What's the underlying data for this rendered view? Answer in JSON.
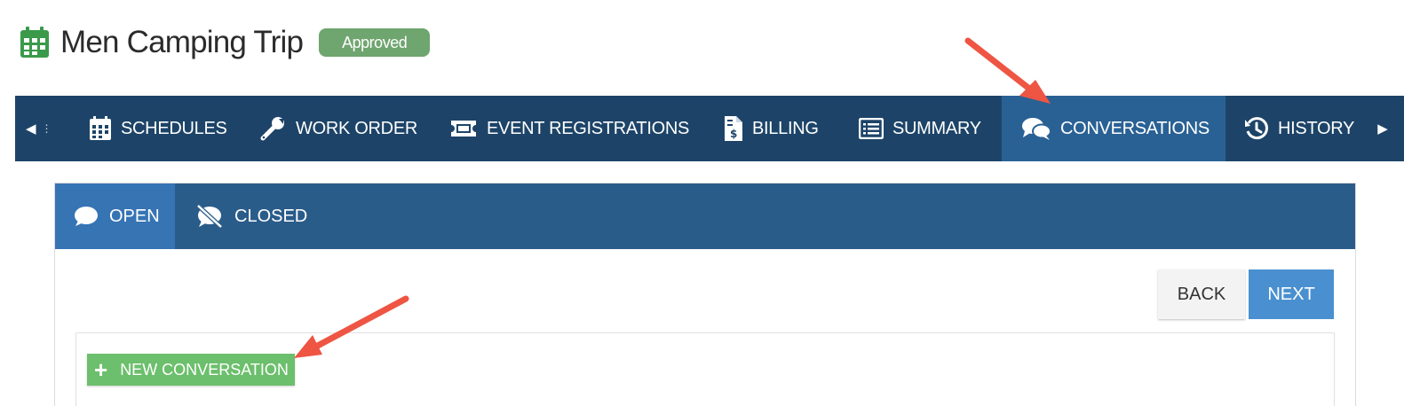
{
  "header": {
    "title": "Men Camping Trip",
    "status_badge": "Approved"
  },
  "nav": {
    "tabs": [
      {
        "label": "SCHEDULES",
        "icon": "calendar-icon"
      },
      {
        "label": "WORK ORDER",
        "icon": "wrench-icon"
      },
      {
        "label": "EVENT REGISTRATIONS",
        "icon": "ticket-icon"
      },
      {
        "label": "BILLING",
        "icon": "invoice-icon"
      },
      {
        "label": "SUMMARY",
        "icon": "list-icon"
      },
      {
        "label": "CONVERSATIONS",
        "icon": "comments-icon",
        "active": true
      },
      {
        "label": "HISTORY",
        "icon": "history-icon"
      }
    ]
  },
  "conversations": {
    "subtabs": [
      {
        "label": "OPEN",
        "icon": "comment-icon",
        "active": true
      },
      {
        "label": "CLOSED",
        "icon": "comment-slash-icon"
      }
    ],
    "back_label": "BACK",
    "next_label": "NEXT",
    "new_conversation_label": "NEW CONVERSATION"
  },
  "colors": {
    "navbar": "#1d4468",
    "active_tab": "#2a6194",
    "subtab_bar": "#2a5c8a",
    "badge": "#6fa56f",
    "next_button": "#4a90d0",
    "new_button": "#6cbf6c",
    "annotation_arrow": "#ee5543"
  }
}
